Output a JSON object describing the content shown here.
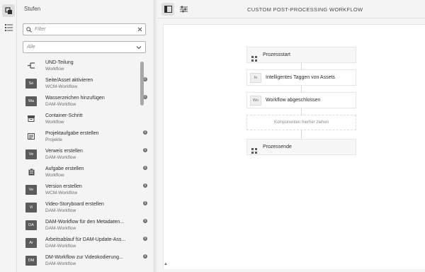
{
  "rail": {
    "icons": [
      "layers-icon",
      "list-icon"
    ]
  },
  "panel": {
    "title": "Stufen",
    "filter_placeholder": "Filter",
    "select_value": "Alle",
    "items": [
      {
        "icon": "branch-icon",
        "badge": "",
        "title": "UND-Teilung",
        "subtitle": "Workflow",
        "info": false
      },
      {
        "icon": "badge",
        "badge": "Se",
        "title": "Seite/Asset aktivieren",
        "subtitle": "WCM-Workflow",
        "info": true
      },
      {
        "icon": "badge",
        "badge": "Wa",
        "title": "Wasserzeichen hinzufügen",
        "subtitle": "DAM-Workflow",
        "info": true
      },
      {
        "icon": "container-icon",
        "badge": "",
        "title": "Container-Schritt",
        "subtitle": "Workflow",
        "info": false
      },
      {
        "icon": "project-icon",
        "badge": "",
        "title": "Projektaufgabe erstellen",
        "subtitle": "Projekte",
        "info": true
      },
      {
        "icon": "badge",
        "badge": "Ve",
        "title": "Verweis erstellen",
        "subtitle": "DAM-Workflow",
        "info": true
      },
      {
        "icon": "clipboard-icon",
        "badge": "",
        "title": "Aufgabe erstellen",
        "subtitle": "Workflow",
        "info": true
      },
      {
        "icon": "badge",
        "badge": "Ve",
        "title": "Version erstellen",
        "subtitle": "WCM-Workflow",
        "info": true
      },
      {
        "icon": "badge",
        "badge": "Vi",
        "title": "Video-Storyboard erstellen",
        "subtitle": "DAM-Workflow",
        "info": true
      },
      {
        "icon": "badge",
        "badge": "DA",
        "title": "DAM-Workflow für den Metadaten...",
        "subtitle": "DAM-Workflow",
        "info": true
      },
      {
        "icon": "badge",
        "badge": "Ar",
        "title": "Arbeitsablauf für DAM-Update-Ass...",
        "subtitle": "DAM-Workflow",
        "info": true
      },
      {
        "icon": "badge",
        "badge": "DM",
        "title": "DM-Workflow zur Videokodierung...",
        "subtitle": "DAM-Workflow",
        "info": true
      }
    ]
  },
  "toolbar": {
    "title": "CUSTOM POST-PROCESSING WORKFLOW"
  },
  "workflow": {
    "start": "Prozessstart",
    "steps": [
      {
        "badge": "In",
        "label": "Intelligentes Taggen von Assets"
      },
      {
        "badge": "Wo",
        "label": "Workflow abgeschlossen"
      }
    ],
    "drop_hint": "Komponenten hierher ziehen",
    "end": "Prozessende"
  },
  "colors": {
    "badge_bg": "#5b5b5b",
    "panel_bg": "#f4f4f4",
    "canvas_bg": "#ffffff"
  }
}
